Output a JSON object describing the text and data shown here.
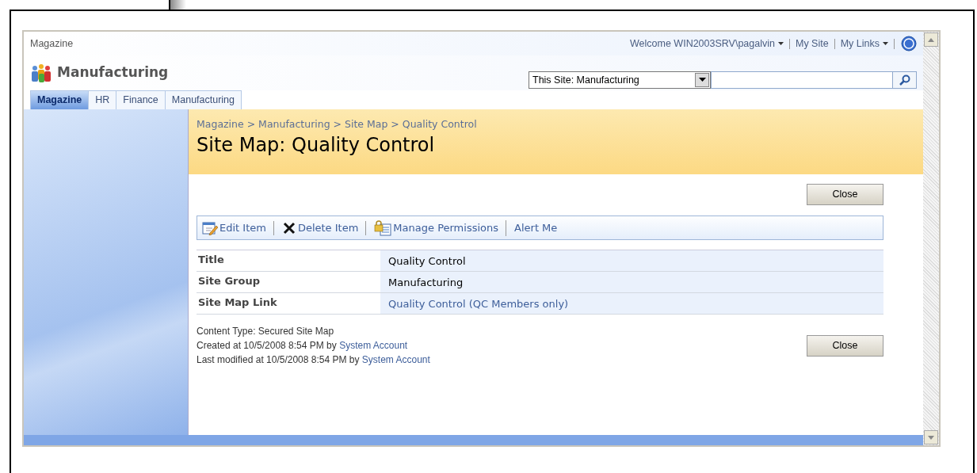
{
  "top_bar": {
    "site_name": "Magazine",
    "user_links": [
      {
        "label": "Welcome WIN2003SRV\\pagalvin",
        "menu": true
      },
      {
        "label": "My Site",
        "menu": false
      },
      {
        "label": "My Links",
        "menu": true
      }
    ]
  },
  "header": {
    "title": "Manufacturing",
    "search_scope": "This Site: Manufacturing"
  },
  "tabs": [
    {
      "label": "Magazine",
      "selected": true
    },
    {
      "label": "HR",
      "selected": false
    },
    {
      "label": "Finance",
      "selected": false
    },
    {
      "label": "Manufacturing",
      "selected": false
    }
  ],
  "breadcrumb": "Magazine > Manufacturing > Site Map > Quality Control",
  "page_title": "Site Map: Quality Control",
  "top_button": "Close",
  "toolbar": [
    {
      "label": "Edit Item",
      "kind": "edit"
    },
    {
      "label": "Delete Item",
      "kind": "delete"
    },
    {
      "label": "Manage Permissions",
      "kind": "permissions"
    },
    {
      "label": "Alert Me",
      "kind": "plain"
    }
  ],
  "fields": [
    {
      "label": "Title",
      "value": "Quality Control",
      "kind": "text"
    },
    {
      "label": "Site Group",
      "value": "Manufacturing",
      "kind": "text"
    },
    {
      "label": "Site Map Link",
      "value": "Quality Control (QC Members only)",
      "kind": "link"
    }
  ],
  "footer": {
    "content_type": "Content Type: Secured Site Map",
    "lines": [
      {
        "text": "Created at 10/5/2008 8:54 PM  by",
        "author": "System Account"
      },
      {
        "text": "Last modified at 10/5/2008 8:54 PM  by",
        "author": "System Account"
      }
    ]
  },
  "bottom_button": "Close"
}
